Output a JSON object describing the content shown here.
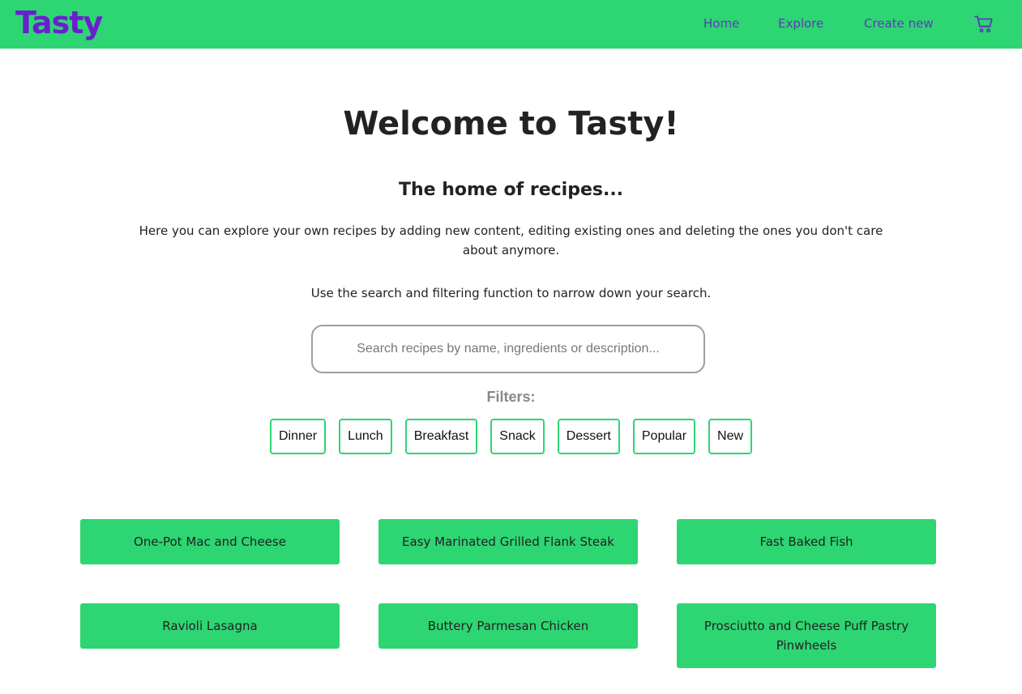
{
  "header": {
    "brand": "Tasty",
    "nav": {
      "home": "Home",
      "explore": "Explore",
      "create": "Create new"
    },
    "cart_icon": "shopping-cart-icon",
    "background_color": "#2ed573",
    "brand_color": "#6a1fcf",
    "link_color": "#5b3bb8"
  },
  "hero": {
    "title": "Welcome to Tasty!",
    "subtitle": "The home of recipes...",
    "description": "Here you can explore your own recipes by adding new content, editing existing ones and deleting the ones you don't care about anymore.",
    "hint": "Use the search and filtering function to narrow down your search."
  },
  "search": {
    "placeholder": "Search recipes by name, ingredients or description...",
    "value": ""
  },
  "filters": {
    "label": "Filters:",
    "items": [
      "Dinner",
      "Lunch",
      "Breakfast",
      "Snack",
      "Dessert",
      "Popular",
      "New"
    ]
  },
  "recipes": [
    "One-Pot Mac and Cheese",
    "Easy Marinated Grilled Flank Steak",
    "Fast Baked Fish",
    "Ravioli Lasagna",
    "Buttery Parmesan Chicken",
    "Prosciutto and Cheese Puff Pastry Pinwheels"
  ]
}
